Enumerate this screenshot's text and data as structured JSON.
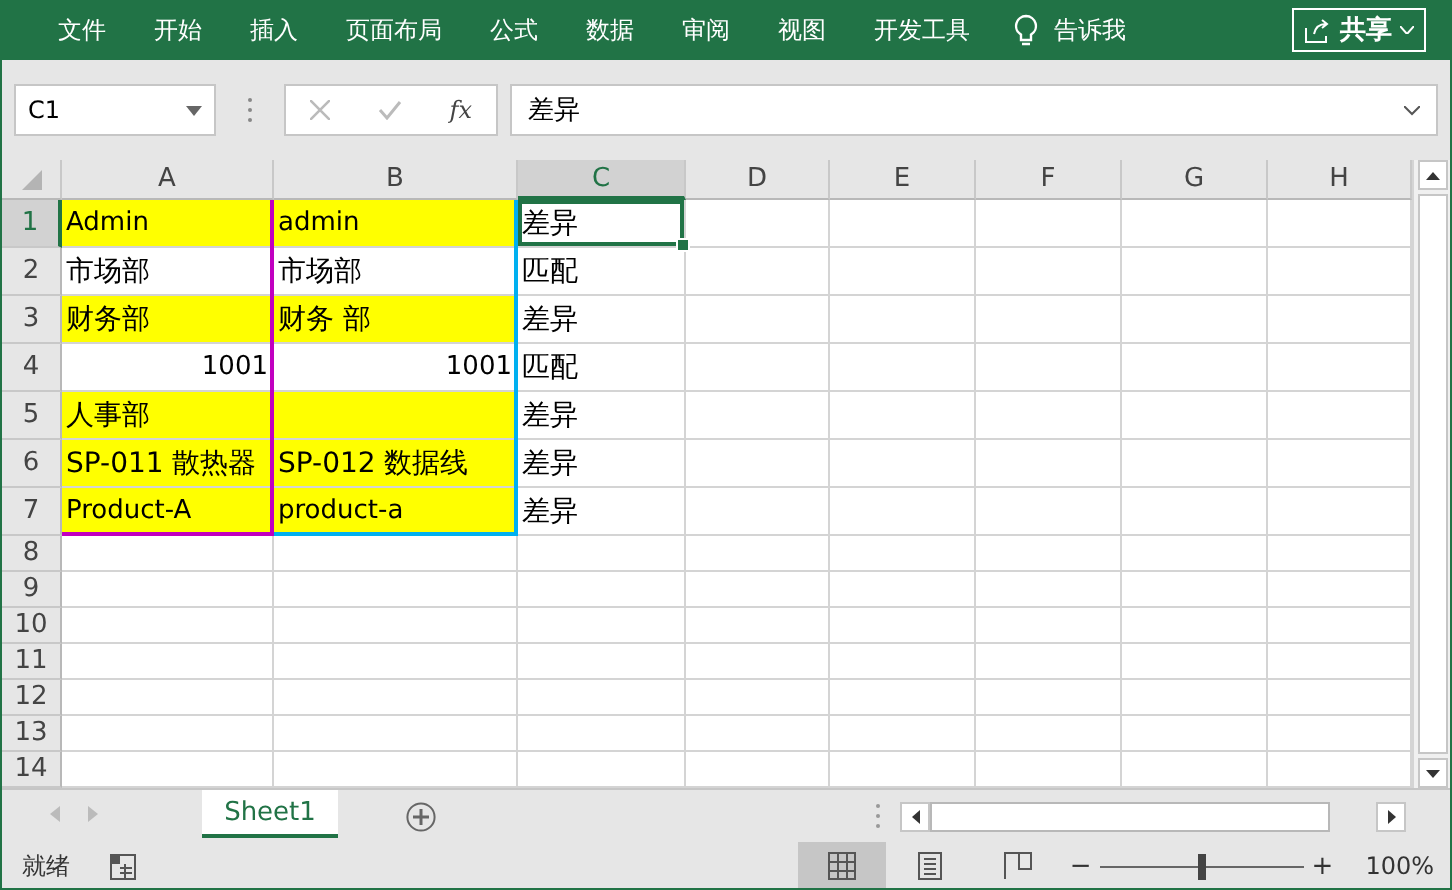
{
  "ribbon": {
    "tabs": [
      "文件",
      "开始",
      "插入",
      "页面布局",
      "公式",
      "数据",
      "审阅",
      "视图",
      "开发工具"
    ],
    "tell_me": "告诉我",
    "share": "共享"
  },
  "formula_bar": {
    "name_box": "C1",
    "function_label": "fx",
    "value": "差异"
  },
  "columns": [
    {
      "label": "A",
      "selected": false,
      "color": "#c000c0"
    },
    {
      "label": "B",
      "selected": false,
      "color": "#00b0f0"
    },
    {
      "label": "C",
      "selected": true
    },
    {
      "label": "D",
      "selected": false
    },
    {
      "label": "E",
      "selected": false
    },
    {
      "label": "F",
      "selected": false
    },
    {
      "label": "G",
      "selected": false
    },
    {
      "label": "H",
      "selected": false
    }
  ],
  "rows": [
    {
      "header": "1",
      "selected": true,
      "cells": [
        {
          "kind": "text",
          "text": "Admin",
          "fill": true,
          "outlined": true
        },
        {
          "kind": "text",
          "text": "admin",
          "fill": true,
          "outlined": true
        },
        {
          "kind": "text",
          "text": "差异",
          "active": true
        }
      ]
    },
    {
      "header": "2",
      "selected": false,
      "cells": [
        {
          "kind": "text",
          "text": "市场部",
          "outlined": true
        },
        {
          "kind": "text",
          "text": "市场部",
          "outlined": true
        },
        {
          "kind": "text",
          "text": "匹配"
        }
      ]
    },
    {
      "header": "3",
      "selected": false,
      "cells": [
        {
          "kind": "text",
          "text": "财务部",
          "fill": true,
          "outlined": true
        },
        {
          "kind": "text",
          "text": "财务 部",
          "fill": true,
          "outlined": true
        },
        {
          "kind": "text",
          "text": "差异"
        }
      ]
    },
    {
      "header": "4",
      "selected": false,
      "cells": [
        {
          "kind": "number",
          "text": "1001",
          "outlined": true
        },
        {
          "kind": "number",
          "text": "1001",
          "outlined": true
        },
        {
          "kind": "text",
          "text": "匹配"
        }
      ]
    },
    {
      "header": "5",
      "selected": false,
      "cells": [
        {
          "kind": "text",
          "text": "人事部",
          "fill": true,
          "outlined": true
        },
        {
          "kind": "text",
          "fill": true,
          "outlined": true
        },
        {
          "kind": "text",
          "text": "差异"
        }
      ]
    },
    {
      "header": "6",
      "selected": false,
      "cells": [
        {
          "kind": "text",
          "text": "SP-011 散热器",
          "fill": true,
          "outlined": true
        },
        {
          "kind": "text",
          "text": "SP-012 数据线",
          "fill": true,
          "outlined": true
        },
        {
          "kind": "text",
          "text": "差异"
        }
      ]
    },
    {
      "header": "7",
      "selected": false,
      "cells": [
        {
          "kind": "text",
          "text": "Product-A",
          "fill": true,
          "outlined": true
        },
        {
          "kind": "text",
          "text": "product-a",
          "fill": true,
          "outlined": true
        },
        {
          "kind": "text",
          "text": "差异"
        }
      ]
    },
    {
      "header": "8",
      "selected": false
    },
    {
      "header": "9",
      "selected": false
    },
    {
      "header": "10",
      "selected": false
    },
    {
      "header": "11",
      "selected": false
    },
    {
      "header": "12",
      "selected": false
    },
    {
      "header": "13",
      "selected": false
    },
    {
      "header": "14",
      "selected": false
    }
  ],
  "sheet_tabs": [
    {
      "label": "Sheet1",
      "selected": true
    }
  ],
  "status_bar": {
    "status": "就绪",
    "views": [
      {
        "kind": "normal",
        "selected": true
      },
      {
        "kind": "page-layout",
        "selected": false
      },
      {
        "kind": "page-break",
        "selected": false
      }
    ],
    "zoom": {
      "minus": "−",
      "plus": "+",
      "level": 0.5,
      "reading": "100%"
    }
  }
}
